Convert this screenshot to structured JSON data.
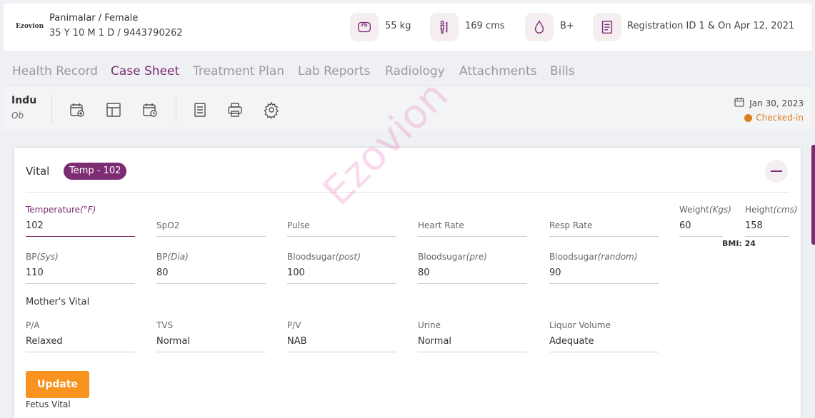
{
  "header": {
    "logo": "Ezovion",
    "patient_name": "Panimalar / Female",
    "patient_info": "35 Y 10 M 1 D / 9443790262",
    "weight": "55 kg",
    "height": "169 cms",
    "blood_group": "B+",
    "registration": "Registration ID 1 & On Apr 12, 2021"
  },
  "tabs": [
    {
      "label": "Health Record"
    },
    {
      "label": "Case Sheet",
      "active": true
    },
    {
      "label": "Treatment Plan"
    },
    {
      "label": "Lab Reports"
    },
    {
      "label": "Radiology"
    },
    {
      "label": "Attachments"
    },
    {
      "label": "Bills"
    }
  ],
  "toolbar": {
    "doctor_name": "Indu",
    "doctor_role": "Ob",
    "date": "Jan 30, 2023",
    "status": "Checked-in"
  },
  "vital": {
    "title": "Vital",
    "badge": "Temp - 102",
    "fields": {
      "temperature": {
        "label": "Temperature",
        "unit": "(°F)",
        "value": "102"
      },
      "spo2": {
        "label": "SpO2",
        "value": ""
      },
      "pulse": {
        "label": "Pulse",
        "value": ""
      },
      "heart_rate": {
        "label": "Heart Rate",
        "value": ""
      },
      "resp_rate": {
        "label": "Resp Rate",
        "value": ""
      },
      "weight": {
        "label": "Weight",
        "unit": "(Kgs)",
        "value": "60"
      },
      "height": {
        "label": "Height",
        "unit": "(cms)",
        "value": "158"
      },
      "bp_sys": {
        "label": "BP",
        "unit": "(Sys)",
        "value": "110"
      },
      "bp_dia": {
        "label": "BP",
        "unit": "(Dia)",
        "value": "80"
      },
      "bs_post": {
        "label": "Bloodsugar",
        "unit": "(post)",
        "value": "100"
      },
      "bs_pre": {
        "label": "Bloodsugar",
        "unit": "(pre)",
        "value": "80"
      },
      "bs_random": {
        "label": "Bloodsugar",
        "unit": "(random)",
        "value": "90"
      }
    },
    "bmi": "BMI: 24"
  },
  "mothers_vital": {
    "title": "Mother's Vital",
    "fields": {
      "pa": {
        "label": "P/A",
        "value": "Relaxed"
      },
      "tvs": {
        "label": "TVS",
        "value": "Normal"
      },
      "pv": {
        "label": "P/V",
        "value": "NAB"
      },
      "urine": {
        "label": "Urine",
        "value": "Normal"
      },
      "liquor": {
        "label": "Liquor Volume",
        "value": "Adequate"
      }
    }
  },
  "update_label": "Update",
  "fetus_title": "Fetus Vital",
  "watermark": "Ezovion",
  "colors": {
    "accent": "#7b2c72",
    "orange": "#f7931e",
    "status": "#e07f1f"
  }
}
